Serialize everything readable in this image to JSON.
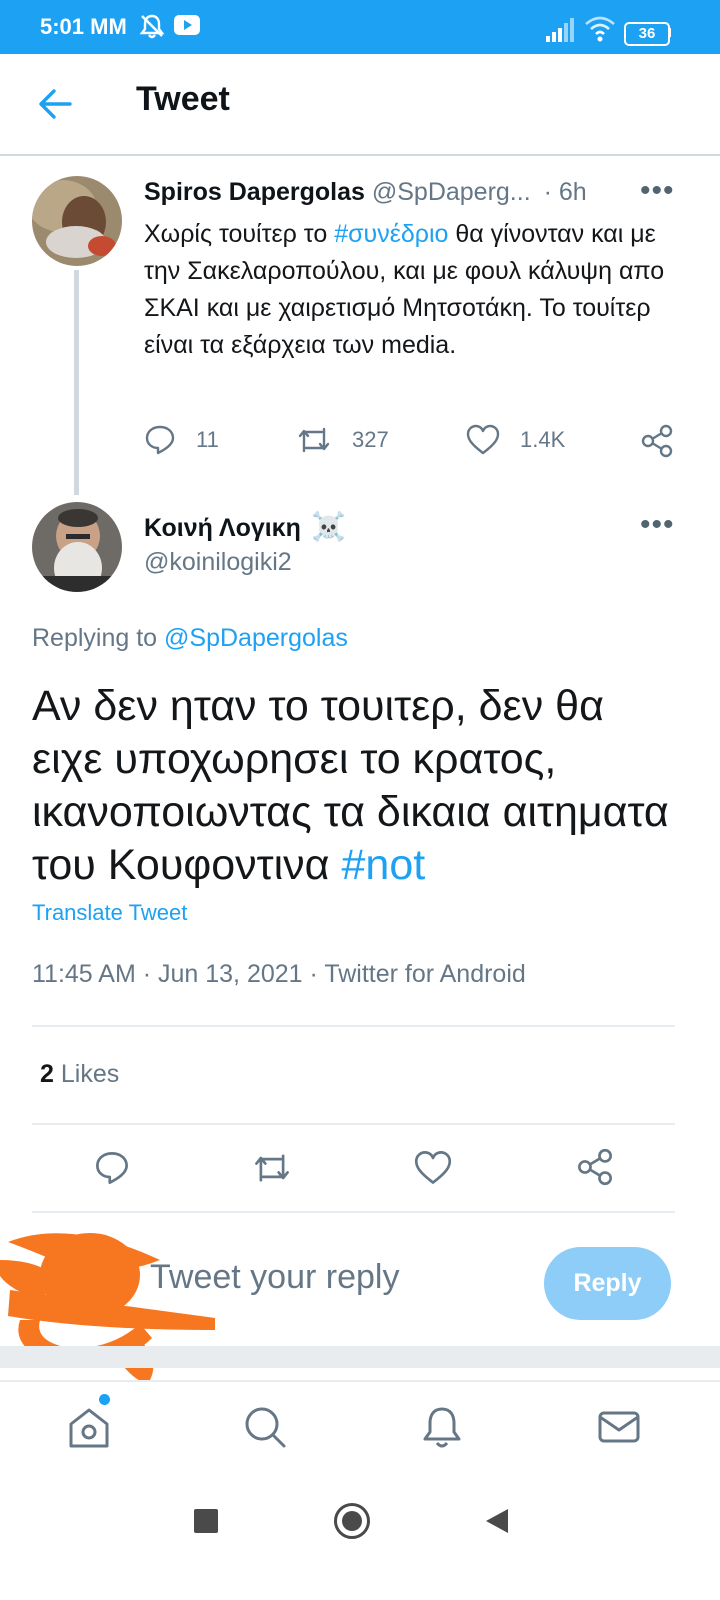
{
  "status_bar": {
    "time": "5:01 MM",
    "battery": "36"
  },
  "header": {
    "title": "Tweet"
  },
  "parent_tweet": {
    "display_name": "Spiros Dapergolas",
    "handle": "@SpDaperg...",
    "time_sep": "·",
    "time": "6h",
    "text_part1": "Χωρίς τουίτερ το ",
    "hashtag": "#συνέδριο",
    "text_part2": " θα γίνονταν και με την Σακελαροπούλου, και με φουλ κάλυψη απο ΣΚΑΙ και με χαιρετισμό Μητσοτάκη. Το τουίτερ είναι τα εξάρχεια των media.",
    "replies": "11",
    "retweets": "327",
    "likes": "1.4K"
  },
  "focused_tweet": {
    "display_name": "Κοινή Λογικη",
    "name_emoji": "☠️",
    "handle": "@koinilogiki2",
    "replying_prefix": "Replying to ",
    "replying_to": "@SpDapergolas",
    "text": "Αν δεν ηταν το τουιτερ, δεν θα ειχε υποχωρησει το κρατος, ικανοποιωντας τα δικαια αιτηματα του Κουφοντινα ",
    "hashtag": "#not",
    "translate_label": "Translate Tweet",
    "timestamp": "11:45 AM · Jun 13, 2021 · Twitter for Android",
    "likes_count": "2",
    "likes_label": "Likes"
  },
  "compose": {
    "placeholder": "Tweet your reply",
    "reply_label": "Reply"
  },
  "colors": {
    "accent": "#1da1f2",
    "muted": "#657786",
    "reply_disabled": "#8dcdf8",
    "redaction": "#f77620"
  },
  "icons": {
    "status": [
      "mute-icon",
      "youtube-icon",
      "signal-icon",
      "wifi-icon",
      "battery-icon"
    ],
    "bottom_nav": [
      "home-icon",
      "search-icon",
      "notifications-icon",
      "messages-icon"
    ],
    "android_nav": [
      "recents-icon",
      "home-circle-icon",
      "back-triangle-icon"
    ]
  }
}
